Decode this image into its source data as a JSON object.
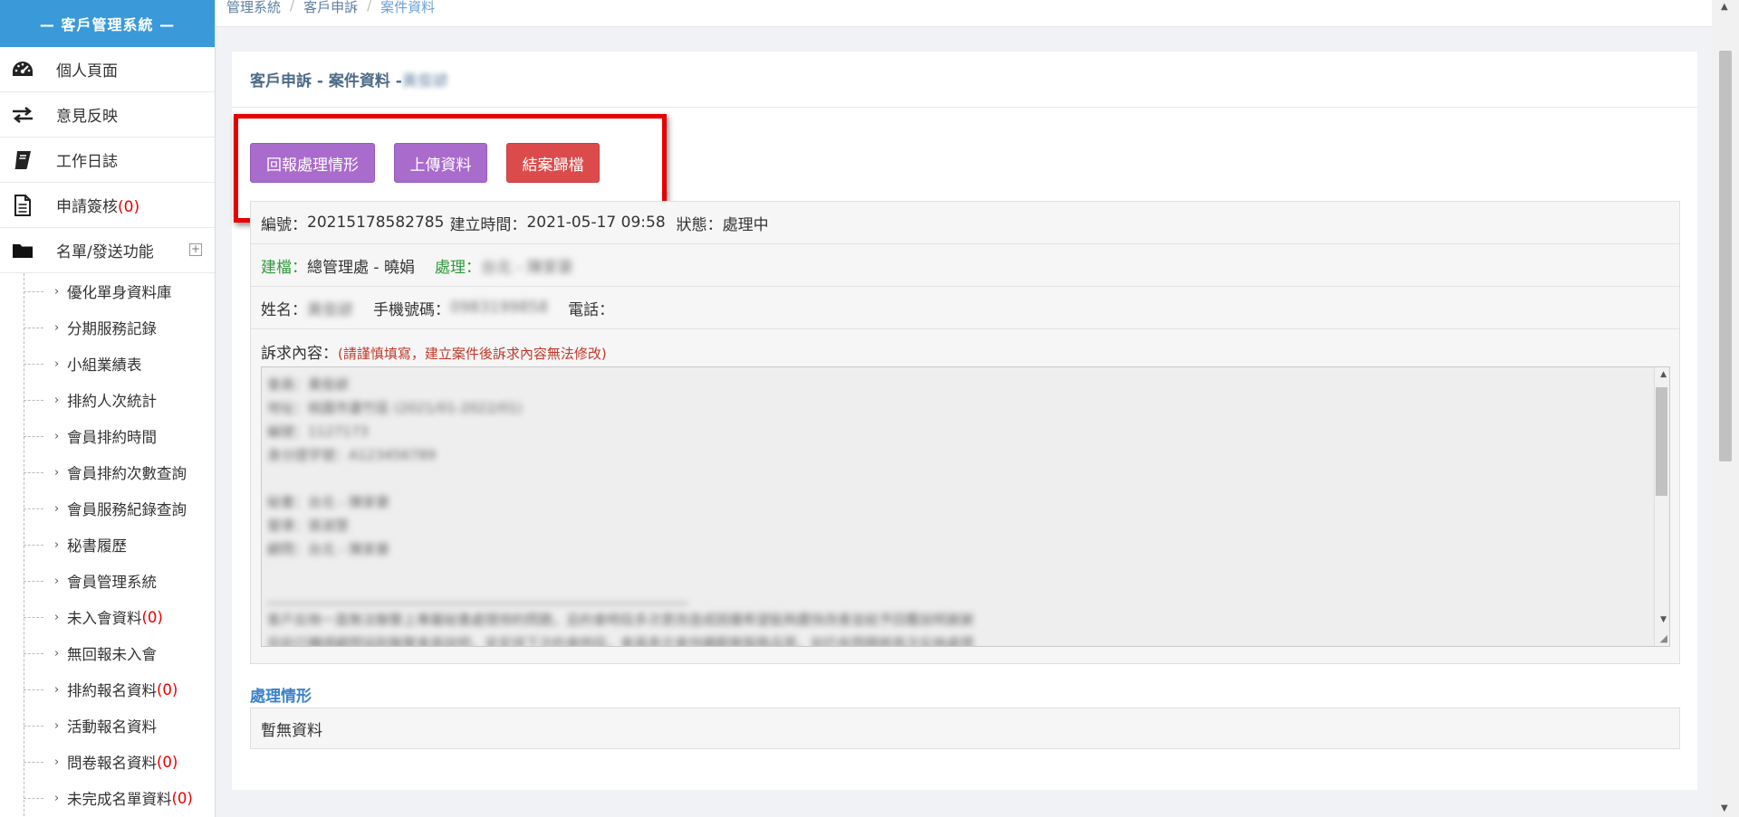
{
  "sidebar": {
    "brand": "— 客戶管理系統 —",
    "items": [
      {
        "label": "個人頁面",
        "icon": "dashboard-icon"
      },
      {
        "label": "意見反映",
        "icon": "exchange-icon"
      },
      {
        "label": "工作日誌",
        "icon": "book-icon"
      },
      {
        "label": "申請簽核",
        "count": "(0)",
        "icon": "document-icon"
      },
      {
        "label": "名單/發送功能",
        "icon": "folder-icon"
      }
    ],
    "expand_symbol": "+",
    "sub_items": [
      {
        "label": "優化單身資料庫",
        "count": ""
      },
      {
        "label": "分期服務記錄",
        "count": ""
      },
      {
        "label": "小組業績表",
        "count": ""
      },
      {
        "label": "排約人次統計",
        "count": ""
      },
      {
        "label": "會員排約時間",
        "count": ""
      },
      {
        "label": "會員排約次數查詢",
        "count": ""
      },
      {
        "label": "會員服務紀錄查詢",
        "count": ""
      },
      {
        "label": "秘書履歷",
        "count": ""
      },
      {
        "label": "會員管理系統",
        "count": ""
      },
      {
        "label": "未入會資料",
        "count": "(0)"
      },
      {
        "label": "無回報未入會",
        "count": ""
      },
      {
        "label": "排約報名資料",
        "count": "(0)"
      },
      {
        "label": "活動報名資料",
        "count": ""
      },
      {
        "label": "問卷報名資料",
        "count": "(0)"
      },
      {
        "label": "未完成名單資料",
        "count": "(0)"
      }
    ]
  },
  "breadcrumb": [
    "管理系統",
    "客戶申訴",
    "案件資料"
  ],
  "panel": {
    "title": "客戶申訴 - 案件資料 - ",
    "title_blurred": "黃俊諺"
  },
  "buttons": {
    "report": "回報處理情形",
    "upload": "上傳資料",
    "close_case": "結案歸檔"
  },
  "info": {
    "id_label": "編號：",
    "id_value": "20215178582785",
    "created_label": "建立時間：",
    "created_value": "2021-05-17 09:58",
    "status_label": "狀態：",
    "status_value": "處理中",
    "creator_label": "建檔：",
    "creator_value": "總管理處 - 曉娟",
    "handler_label": "處理：",
    "handler_value": "台北 - 陳家豪",
    "name_label": "姓名：",
    "name_value": "黃俊諺",
    "mobile_label": "手機號碼：",
    "mobile_value": "0983199858",
    "phone_label": "電話：",
    "request_label": "訴求內容：",
    "request_note": "(請謹慎填寫，建立案件後訴求內容無法修改)",
    "request_lines": [
      "會員：黃俊諺",
      "地址：桃園市蘆竹區 (2021/01-2022/01)",
      "編號：1127173",
      "身分證字號：A123456789",
      "",
      "秘書：台北 - 陳家豪",
      "督導：張淑慧",
      "顧問：台北 - 陳家豪",
      "",
      "______________________________________________________________",
      "客戶反映一直無法聯繫上專屬秘書處理排約問題，且約會時段多次更改造成困擾希望能夠盡快改善並給予回覆說明謝謝",
      "目前已轉請顧問協助聯繫會員說明，並安排下次約會時段，會員表示會持續觀察服務品質，如仍有問題將再次反映處理"
    ]
  },
  "process": {
    "title": "處理情形",
    "empty": "暫無資料"
  }
}
